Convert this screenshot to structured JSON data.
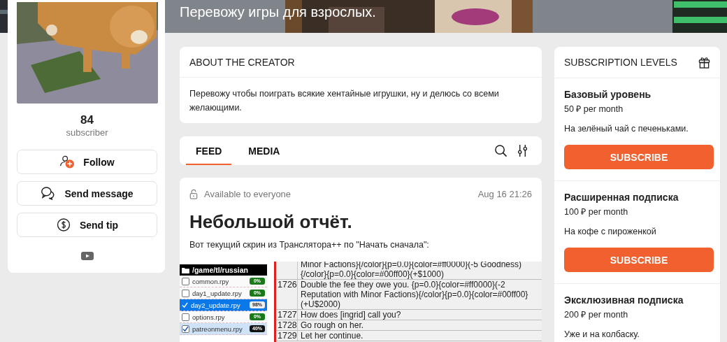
{
  "banner": {
    "kind": "picture",
    "tagline": "Перевожу игры для взрослых."
  },
  "profile": {
    "subscriber_count": "84",
    "subscriber_label": "subscriber",
    "actions": [
      {
        "kind": "follow",
        "label": "Follow"
      },
      {
        "kind": "message",
        "label": "Send message"
      },
      {
        "kind": "tip",
        "label": "Send tip"
      }
    ],
    "socials": [
      {
        "kind": "youtube"
      }
    ]
  },
  "about": {
    "title": "ABOUT THE CREATOR",
    "text": "Перевожу чтобы поиграть всякие хентайные игрушки, ну и делюсь со всеми желающими."
  },
  "feed_tabs": [
    {
      "label": "FEED",
      "selected": true
    },
    {
      "label": "MEDIA",
      "selected": false
    }
  ],
  "post": {
    "access": "Available to everyone",
    "date": "Aug 16 21:26",
    "title": "Небольшой отчёт.",
    "text": "Вот текущий скрин из Транслятора++ по \"Начать сначала\":",
    "screenshot": {
      "folder": "/game/tl/russian",
      "files": [
        {
          "name": "common.rpy",
          "checked": false,
          "selected": false,
          "percent": "0%",
          "color": "#1a7a1a"
        },
        {
          "name": "day1_update.rpy",
          "checked": false,
          "selected": false,
          "percent": "0%",
          "color": "#1a7a1a"
        },
        {
          "name": "day2_update.rpy",
          "checked": true,
          "selected": true,
          "percent": "98%",
          "color": "#f0f0f0"
        },
        {
          "name": "options.rpy",
          "checked": false,
          "selected": false,
          "percent": "0%",
          "color": "#1a7a1a"
        },
        {
          "name": "patreonmenu.rpy",
          "checked": true,
          "selected": false,
          "percent": "40%",
          "color": "#111111"
        }
      ],
      "lines": [
        {
          "text": "Minor Factions}{/color}{p=0.0}{color=#ff0000}(-5 Goodness)\n{/color}{p=0.0}{color=#00ff00}(+$1000)"
        },
        {
          "number": "1726",
          "text": "Double the fee they owe you. {p=0.0}{color=#ff0000}(-2\nReputation with Minor Factions){/color}{p=0.0}{color=#00ff00}\n(+U$2000)"
        },
        {
          "number": "1727",
          "text": "How does [ingrid] call you?"
        },
        {
          "number": "1728",
          "text": "Go rough on her."
        },
        {
          "number": "1729",
          "text": "Let her continue."
        }
      ]
    }
  },
  "subscription": {
    "title": "SUBSCRIPTION LEVELS",
    "tiers": [
      {
        "name": "Базовый уровень",
        "price": "50 ₽ per month",
        "description": "На зелёный чай с печеньками.",
        "button": "SUBSCRIBE"
      },
      {
        "name": "Расширенная подписка",
        "price": "100 ₽ per month",
        "description": "На кофе с пироженкой",
        "button": "SUBSCRIBE"
      },
      {
        "name": "Эксклюзивная подписка",
        "price": "200 ₽ per month",
        "description": "Уже и на колбаску."
      }
    ]
  }
}
